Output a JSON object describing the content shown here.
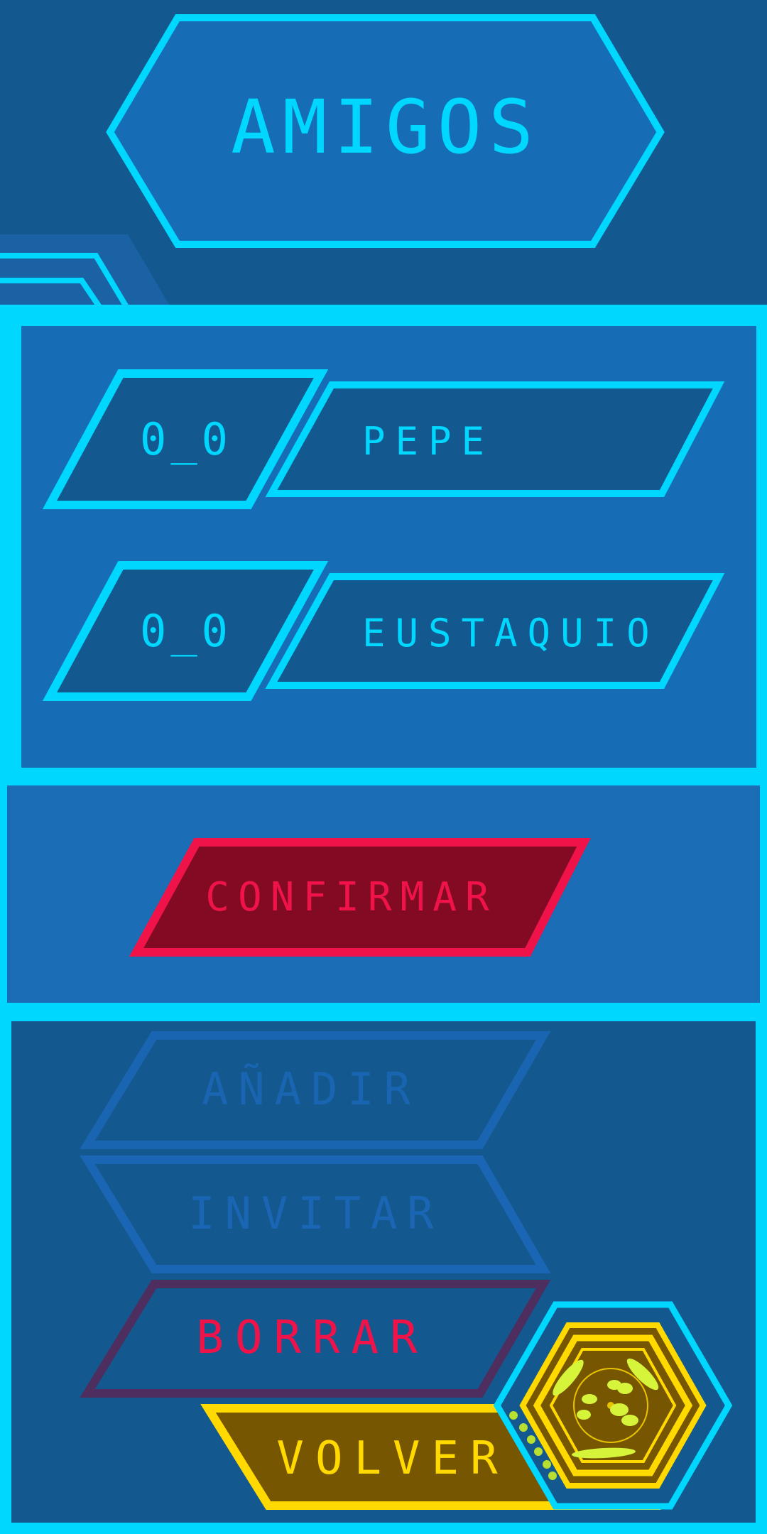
{
  "header": {
    "title": "AMIGOS"
  },
  "friends": [
    {
      "status": "0_0",
      "name": "PEPE"
    },
    {
      "status": "0_0",
      "name": "EUSTAQUIO"
    }
  ],
  "actions": {
    "confirm": "CONFIRMAR",
    "add": "AÑADIR",
    "invite": "INVITAR",
    "delete": "BORRAR",
    "back": "VOLVER"
  },
  "icons": {
    "emblem": "yellow-hexagon-emblem-icon"
  },
  "colors": {
    "background": "#13598f",
    "panel": "#1b6db5",
    "cyan_accent": "#00d7ff",
    "confirm_fill": "#820a23",
    "confirm_border": "#f0134a",
    "back_fill": "#765600",
    "back_border": "#ffd900",
    "disabled": "#1a66b4"
  }
}
